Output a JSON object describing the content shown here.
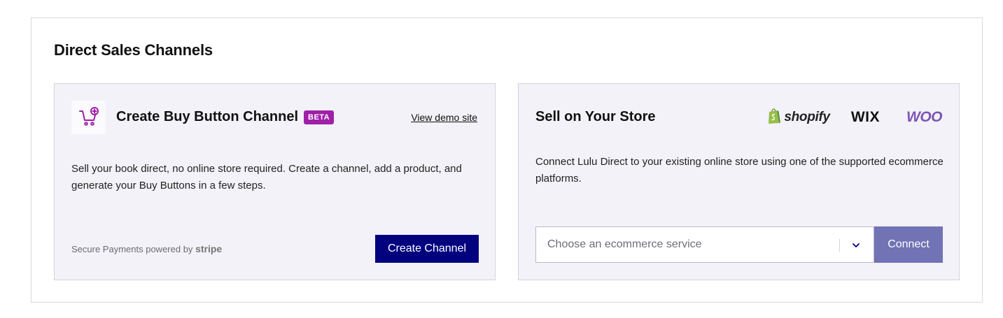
{
  "section": {
    "title": "Direct Sales Channels"
  },
  "buy_button_card": {
    "icon": "cart-plus-icon",
    "title": "Create Buy Button Channel",
    "badge": "BETA",
    "demo_link": "View demo site",
    "description": "Sell your book direct, no online store required. Create a channel, add a product, and generate your Buy Buttons in a few steps.",
    "secure_text": "Secure Payments powered by",
    "secure_brand": "stripe",
    "create_button": "Create Channel",
    "colors": {
      "badge": "#a01fa8",
      "button": "#02027e",
      "icon": "#a01fa8"
    }
  },
  "store_card": {
    "title": "Sell on Your Store",
    "logos": [
      {
        "name": "shopify",
        "icon": "shopify-bag-icon",
        "color": "#95bf47"
      },
      {
        "name": "WIX"
      },
      {
        "name": "WOO",
        "color": "#7f54b3"
      }
    ],
    "description": "Connect Lulu Direct to your existing online store using one of the supported ecommerce platforms.",
    "select": {
      "placeholder": "Choose an ecommerce service",
      "icon": "chevron-down-icon"
    },
    "connect_button": "Connect",
    "colors": {
      "button": "#7173b5"
    }
  }
}
